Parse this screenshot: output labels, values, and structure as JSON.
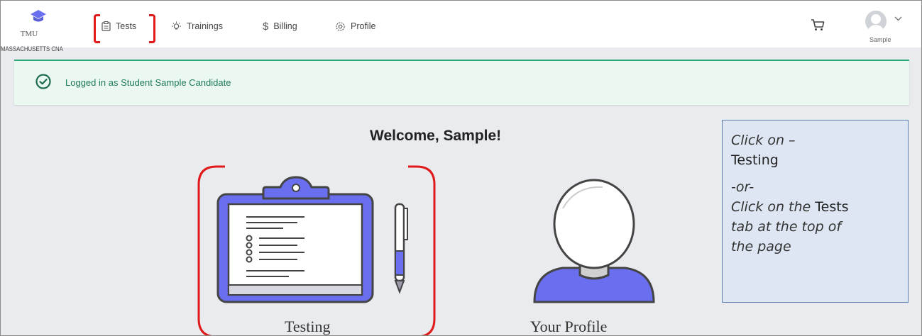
{
  "brand": {
    "short": "TMU",
    "full": "MASSACHUSETTS CNA"
  },
  "nav": {
    "tests": "Tests",
    "trainings": "Trainings",
    "billing": "Billing",
    "profile": "Profile"
  },
  "user": {
    "name": "Sample"
  },
  "alert": {
    "message": "Logged in as Student Sample Candidate"
  },
  "welcome": "Welcome, Sample!",
  "cards": {
    "testing": "Testing",
    "profile": "Your Profile"
  },
  "callout": {
    "line1": "Click on –",
    "line1_bold": "Testing",
    "line2": "-or-",
    "line3_prefix": "Click on the ",
    "line3_bold": "Tests",
    "line4": "tab at the top of",
    "line5": "the page"
  },
  "colors": {
    "brand_purple": "#6a6ff0",
    "highlight_red": "#e01a1a",
    "success_green": "#2fa87c",
    "callout_bg": "#dde6f2"
  }
}
